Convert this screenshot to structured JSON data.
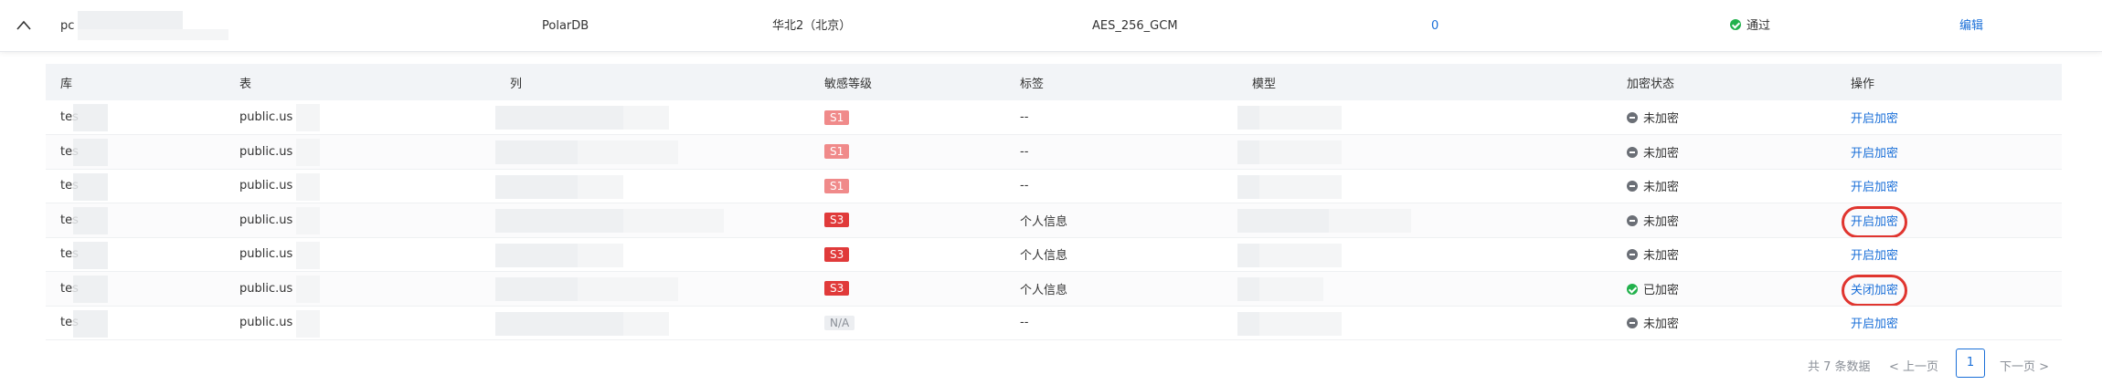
{
  "summary": {
    "instance_name": "pc",
    "db_type": "PolarDB",
    "region": "华北2（北京）",
    "algorithm": "AES_256_GCM",
    "count": "0",
    "status": "通过",
    "edit_label": "编辑"
  },
  "columns": [
    "库",
    "表",
    "列",
    "敏感等级",
    "标签",
    "模型",
    "加密状态",
    "操作"
  ],
  "rows": [
    {
      "db": "tes",
      "table": "public.us",
      "level": "S1",
      "tag": "--",
      "state": "未加密",
      "action": "开启加密",
      "encrypted": false
    },
    {
      "db": "tes",
      "table": "public.us",
      "level": "S1",
      "tag": "--",
      "state": "未加密",
      "action": "开启加密",
      "encrypted": false
    },
    {
      "db": "tes",
      "table": "public.us",
      "level": "S1",
      "tag": "--",
      "state": "未加密",
      "action": "开启加密",
      "encrypted": false
    },
    {
      "db": "tes",
      "table": "public.us",
      "level": "S3",
      "tag": "个人信息",
      "state": "未加密",
      "action": "开启加密",
      "encrypted": false
    },
    {
      "db": "tes",
      "table": "public.us",
      "level": "S3",
      "tag": "个人信息",
      "state": "未加密",
      "action": "开启加密",
      "encrypted": false
    },
    {
      "db": "tes",
      "table": "public.us",
      "level": "S3",
      "tag": "个人信息",
      "state": "已加密",
      "action": "关闭加密",
      "encrypted": true
    },
    {
      "db": "tes",
      "table": "public.us",
      "level": "N/A",
      "tag": "--",
      "state": "未加密",
      "action": "开启加密",
      "encrypted": false
    }
  ],
  "pagination": {
    "total": "共 7 条数据",
    "prev": "< 上一页",
    "page": "1",
    "next": "下一页 >"
  },
  "colors": {
    "link": "#1a6fd8",
    "passed": "#22b14c",
    "s1": "#f08a8a",
    "s3": "#e03a3a"
  }
}
